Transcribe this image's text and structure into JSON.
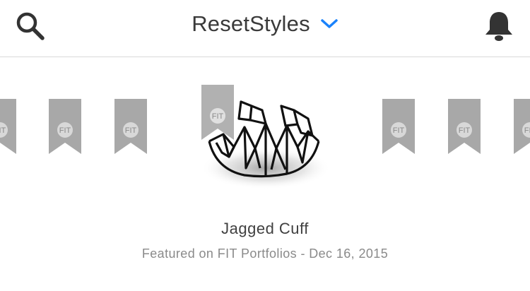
{
  "header": {
    "title": "ResetStyles",
    "left_icon": "search-icon",
    "title_icon": "chevron-down-icon",
    "right_icon": "bell-icon"
  },
  "carousel": {
    "badge_text": "FIT",
    "product_name": "Jagged Cuff",
    "featured_line": "Featured on FIT Portfolios - Dec 16, 2015"
  },
  "colors": {
    "accent": "#1a82fb",
    "icon": "#333333",
    "ribbon": "#a8a8a8"
  }
}
